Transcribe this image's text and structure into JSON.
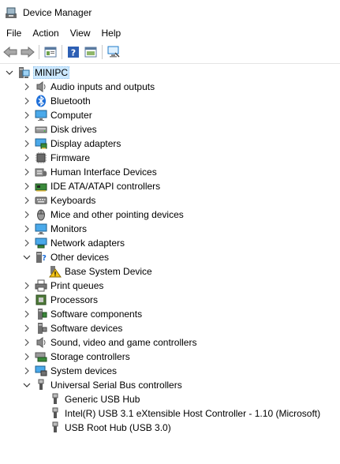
{
  "window": {
    "title": "Device Manager"
  },
  "menu": {
    "items": [
      "File",
      "Action",
      "View",
      "Help"
    ]
  },
  "toolbar": {
    "buttons": [
      "back-icon",
      "forward-icon",
      "properties-icon",
      "help-icon",
      "show-hidden-icon",
      "scan-hardware-icon"
    ]
  },
  "tree": {
    "root": {
      "label": "MINIPC",
      "expanded": true
    },
    "categories": [
      {
        "label": "Audio inputs and outputs",
        "icon": "speaker-icon",
        "expanded": false
      },
      {
        "label": "Bluetooth",
        "icon": "bluetooth-icon",
        "expanded": false
      },
      {
        "label": "Computer",
        "icon": "computer-icon",
        "expanded": false
      },
      {
        "label": "Disk drives",
        "icon": "disk-drive-icon",
        "expanded": false
      },
      {
        "label": "Display adapters",
        "icon": "display-adapter-icon",
        "expanded": false
      },
      {
        "label": "Firmware",
        "icon": "firmware-icon",
        "expanded": false
      },
      {
        "label": "Human Interface Devices",
        "icon": "hid-icon",
        "expanded": false
      },
      {
        "label": "IDE ATA/ATAPI controllers",
        "icon": "ide-controller-icon",
        "expanded": false
      },
      {
        "label": "Keyboards",
        "icon": "keyboard-icon",
        "expanded": false
      },
      {
        "label": "Mice and other pointing devices",
        "icon": "mouse-icon",
        "expanded": false
      },
      {
        "label": "Monitors",
        "icon": "monitor-icon",
        "expanded": false
      },
      {
        "label": "Network adapters",
        "icon": "network-adapter-icon",
        "expanded": false
      },
      {
        "label": "Other devices",
        "icon": "other-devices-icon",
        "expanded": true,
        "children": [
          {
            "label": "Base System Device",
            "icon": "warning-device-icon"
          }
        ]
      },
      {
        "label": "Print queues",
        "icon": "printer-icon",
        "expanded": false
      },
      {
        "label": "Processors",
        "icon": "processor-icon",
        "expanded": false
      },
      {
        "label": "Software components",
        "icon": "software-component-icon",
        "expanded": false
      },
      {
        "label": "Software devices",
        "icon": "software-device-icon",
        "expanded": false
      },
      {
        "label": "Sound, video and game controllers",
        "icon": "sound-controller-icon",
        "expanded": false
      },
      {
        "label": "Storage controllers",
        "icon": "storage-controller-icon",
        "expanded": false
      },
      {
        "label": "System devices",
        "icon": "system-devices-icon",
        "expanded": false
      },
      {
        "label": "Universal Serial Bus controllers",
        "icon": "usb-icon",
        "expanded": true,
        "children": [
          {
            "label": "Generic USB Hub",
            "icon": "usb-plug-icon"
          },
          {
            "label": "Intel(R) USB 3.1 eXtensible Host Controller - 1.10 (Microsoft)",
            "icon": "usb-plug-icon"
          },
          {
            "label": "USB Root Hub (USB 3.0)",
            "icon": "usb-plug-icon"
          }
        ]
      }
    ]
  },
  "colors": {
    "selection": "#cce8ff",
    "accent": "#0078d7"
  }
}
